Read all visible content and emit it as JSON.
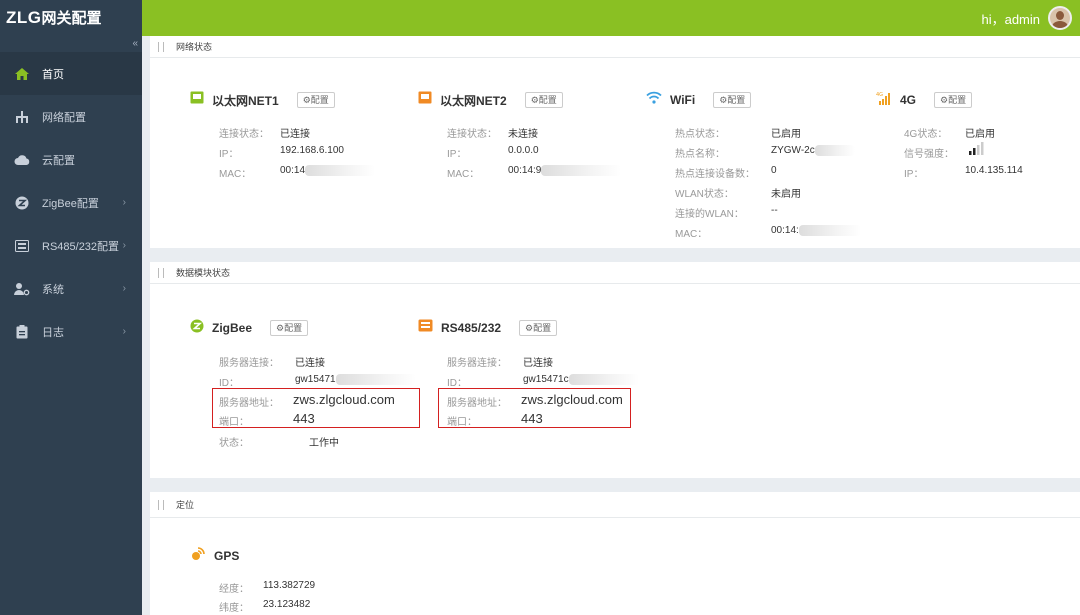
{
  "app": {
    "logo_prefix": "ZLG",
    "logo_suffix": "网关配置",
    "greeting": "hi，admin"
  },
  "sidebar": {
    "collapse": "«",
    "items": [
      {
        "label": "首页",
        "icon": "home-icon"
      },
      {
        "label": "网络配置",
        "icon": "network-icon"
      },
      {
        "label": "云配置",
        "icon": "cloud-icon"
      },
      {
        "label": "ZigBee配置",
        "icon": "zigbee-icon",
        "arrow": "›"
      },
      {
        "label": "RS485/232配置",
        "icon": "serial-icon",
        "arrow": "›"
      },
      {
        "label": "系统",
        "icon": "system-icon",
        "arrow": "›"
      },
      {
        "label": "日志",
        "icon": "log-icon",
        "arrow": "›"
      }
    ]
  },
  "config_label": "⚙配置",
  "network": {
    "title": "网络状态",
    "cards": [
      {
        "title": "以太网NET1",
        "rows": [
          {
            "label": "连接状态：",
            "value": "已连接"
          },
          {
            "label": "IP：",
            "value": "192.168.6.100"
          },
          {
            "label": "MAC：",
            "value": "00:14"
          }
        ]
      },
      {
        "title": "以太网NET2",
        "rows": [
          {
            "label": "连接状态：",
            "value": "未连接"
          },
          {
            "label": "IP：",
            "value": "0.0.0.0"
          },
          {
            "label": "MAC：",
            "value": "00:14:9"
          }
        ]
      },
      {
        "title": "WiFi",
        "rows": [
          {
            "label": "热点状态：",
            "value": "已启用"
          },
          {
            "label": "热点名称：",
            "value": "ZYGW-2c"
          },
          {
            "label": "热点连接设备数：",
            "value": "0"
          },
          {
            "label": "WLAN状态：",
            "value": "未启用"
          },
          {
            "label": "连接的WLAN：",
            "value": "--"
          },
          {
            "label": "MAC：",
            "value": "00:14:"
          }
        ]
      },
      {
        "title": "4G",
        "rows": [
          {
            "label": "4G状态：",
            "value": "已启用"
          },
          {
            "label": "信号强度：",
            "value": ""
          },
          {
            "label": "IP：",
            "value": "10.4.135.114"
          }
        ]
      }
    ]
  },
  "data_module": {
    "title": "数据模块状态",
    "cards": [
      {
        "title": "ZigBee",
        "rows": [
          {
            "label": "服务器连接：",
            "value": "已连接"
          },
          {
            "label": "ID：",
            "value": "gw15471"
          },
          {
            "label": "服务器地址：",
            "value": "zws.zlgcloud.com"
          },
          {
            "label": "端口：",
            "value": "443"
          },
          {
            "label": "状态：",
            "value": "工作中"
          }
        ]
      },
      {
        "title": "RS485/232",
        "rows": [
          {
            "label": "服务器连接：",
            "value": "已连接"
          },
          {
            "label": "ID：",
            "value": "gw15471c"
          },
          {
            "label": "服务器地址：",
            "value": "zws.zlgcloud.com"
          },
          {
            "label": "端口：",
            "value": "443"
          }
        ]
      }
    ]
  },
  "location": {
    "title": "定位",
    "gps": {
      "title": "GPS",
      "rows": [
        {
          "label": "经度：",
          "value": "113.382729"
        },
        {
          "label": "纬度：",
          "value": "23.123482"
        }
      ]
    }
  },
  "signal_level_fraction": 0.5,
  "colors": {
    "sidebar": "#2f4050",
    "topbar": "#8ac023",
    "accent": "#8ac023",
    "highlight": "#d42020"
  }
}
